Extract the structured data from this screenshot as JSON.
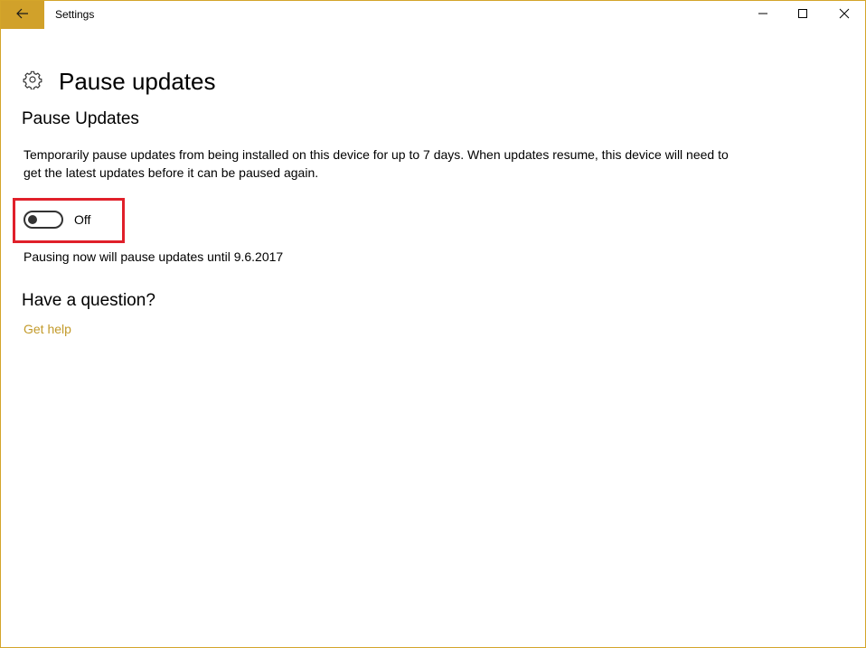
{
  "window": {
    "title": "Settings",
    "accent_color": "#d1a12a",
    "highlight_color": "#e0202a"
  },
  "titlebar": {
    "back_icon": "back-arrow-icon",
    "minimize_icon": "minimize-icon",
    "maximize_icon": "maximize-icon",
    "close_icon": "close-icon"
  },
  "header": {
    "icon": "gear-icon",
    "title": "Pause updates"
  },
  "pause_section": {
    "title": "Pause Updates",
    "description": "Temporarily pause updates from being installed on this device for up to 7 days. When updates resume, this device will need to get the latest updates before it can be paused again.",
    "toggle": {
      "state": "off",
      "label": "Off"
    },
    "pause_until_text": "Pausing now will pause updates until 9.6.2017"
  },
  "help_section": {
    "title": "Have a question?",
    "link_label": "Get help"
  }
}
